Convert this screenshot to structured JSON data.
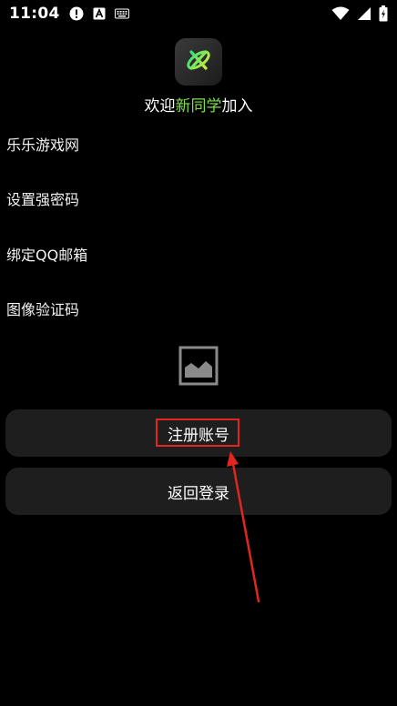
{
  "status_bar": {
    "time": "11:04",
    "icons": [
      "alert-circle-icon",
      "font-a-icon",
      "keyboard-icon",
      "wifi-icon",
      "signal-icon",
      "battery-icon"
    ]
  },
  "header": {
    "logo_icon": "orbit-x-icon",
    "welcome_prefix": "欢迎",
    "welcome_accent": "新同学",
    "welcome_suffix": "加入",
    "accent_color": "#7ee04a"
  },
  "form": {
    "username_placeholder": "乐乐游戏网",
    "password_placeholder": "设置强密码",
    "email_placeholder": "绑定QQ邮箱",
    "captcha_placeholder": "图像验证码",
    "captcha_image_icon": "image-placeholder-icon"
  },
  "actions": {
    "register_label": "注册账号",
    "back_label": "返回登录"
  },
  "annotation": {
    "highlight_color": "#e0261e"
  }
}
